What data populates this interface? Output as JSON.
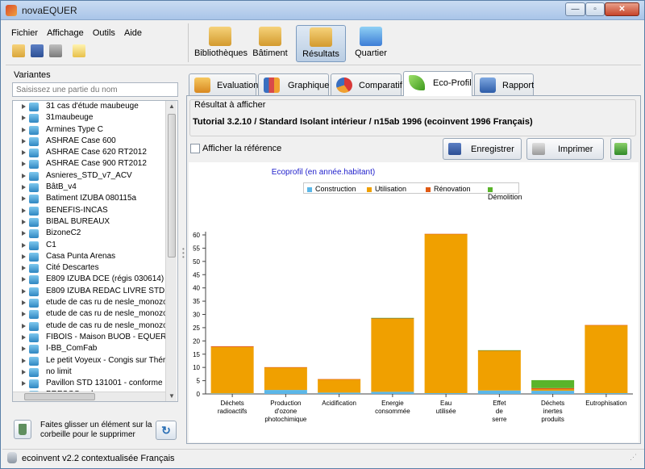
{
  "window": {
    "title": "novaEQUER"
  },
  "menu": {
    "items": [
      "Fichier",
      "Affichage",
      "Outils",
      "Aide"
    ]
  },
  "toolbar": {
    "buttons": [
      "Bibliothèques",
      "Bâtiment",
      "Résultats",
      "Quartier"
    ],
    "active": "Résultats"
  },
  "left": {
    "title": "Variantes",
    "search_placeholder": "Saisissez une partie du nom",
    "items": [
      "31 cas d'étude maubeuge",
      "31maubeuge",
      "Armines Type C",
      "ASHRAE Case 600",
      "ASHRAE Case 620 RT2012",
      "ASHRAE Case 900 RT2012",
      "Asnieres_STD_v7_ACV",
      "BâtB_v4",
      "Batiment IZUBA 080115a",
      "BENEFIS-INCAS",
      "BIBAL BUREAUX",
      "BizoneC2",
      "C1",
      "Casa Punta Arenas",
      "Cité Descartes",
      "E809 IZUBA DCE (régis 030614)",
      "E809 IZUBA REDAC LIVRE STD",
      "etude de cas ru de nesle_monozon",
      "etude de cas ru de nesle_monozon",
      "etude de cas ru de nesle_monozon",
      "FIBOIS - Maison BUOB - EQUER",
      "I-BB_ComFab",
      "Le petit Voyeux - Congis sur Thérou",
      "no limit",
      "Pavillon STD 131001 - conforme RT",
      "PRESCO-cube"
    ],
    "trash_text": "Faites glisser un élément sur la corbeille pour le supprimer"
  },
  "tabs": [
    {
      "label": "Evaluation",
      "color": "#e8a030"
    },
    {
      "label": "Graphique",
      "color": "#c04040"
    },
    {
      "label": "Comparatif",
      "color": "#d83838"
    },
    {
      "label": "Eco-Profil",
      "color": "#5aaa2a"
    },
    {
      "label": "Rapport",
      "color": "#3a6fb0"
    }
  ],
  "active_tab": "Eco-Profil",
  "result": {
    "label": "Résultat à afficher",
    "value": "Tutorial 3.2.10 / Standard Isolant intérieur / n15ab 1996 (ecoinvent 1996 Français)"
  },
  "reference_label": "Afficher la référence",
  "buttons": {
    "save": "Enregistrer",
    "print": "Imprimer"
  },
  "statusbar": {
    "text": "ecoinvent v2.2 contextualisée Français"
  },
  "colors": {
    "construction": "#5bb7e8",
    "utilisation": "#f0a000",
    "renovation": "#e05a14",
    "demolition": "#5ab42a"
  },
  "chart_data": {
    "type": "bar",
    "title": "Ecoprofil (en année.habitant)",
    "stacked": true,
    "categories": [
      [
        "Déchets",
        "radioactifs"
      ],
      [
        "Production",
        "d'ozone",
        "photochimique"
      ],
      [
        "Acidification"
      ],
      [
        "Energie",
        "consommée"
      ],
      [
        "Eau",
        "utilisée"
      ],
      [
        "Effet",
        "de",
        "serre"
      ],
      [
        "Déchets",
        "inertes",
        "produits"
      ],
      [
        "Eutrophisation"
      ]
    ],
    "series": [
      {
        "name": "Construction",
        "color": "#5bb7e8",
        "values": [
          0.2,
          1.5,
          0.5,
          0.8,
          0.3,
          1.3,
          1.2,
          0.3
        ]
      },
      {
        "name": "Utilisation",
        "color": "#f0a000",
        "values": [
          17.5,
          8.5,
          5.0,
          27.6,
          60.0,
          15.0,
          0.5,
          25.6
        ]
      },
      {
        "name": "Rénovation",
        "color": "#e05a14",
        "values": [
          0.3,
          0.1,
          0.1,
          0.1,
          0.1,
          0.1,
          0.5,
          0.1
        ]
      },
      {
        "name": "Démolition",
        "color": "#5ab42a",
        "values": [
          0.0,
          0.0,
          0.0,
          0.2,
          0.0,
          0.1,
          3.0,
          0.0
        ]
      }
    ],
    "yticks": [
      0,
      5,
      10,
      15,
      20,
      25,
      30,
      35,
      40,
      45,
      50,
      55,
      60
    ],
    "ylim": [
      0,
      60
    ],
    "legend_position": "top",
    "grid": false
  }
}
